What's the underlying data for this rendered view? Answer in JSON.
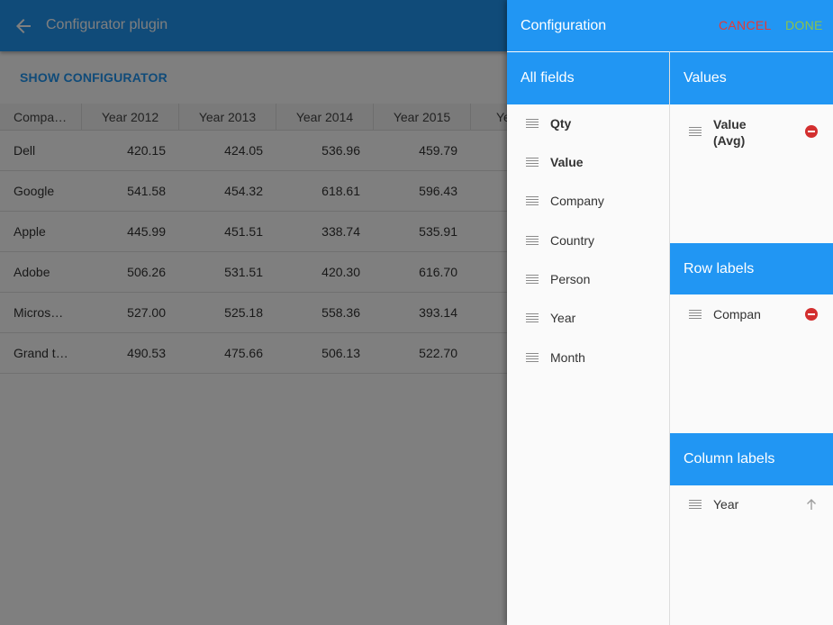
{
  "app": {
    "title": "Configurator plugin",
    "show_button": "SHOW CONFIGURATOR",
    "grid": {
      "headers": [
        "Compa…",
        "Year 2012",
        "Year 2013",
        "Year 2014",
        "Year 2015",
        "Ye"
      ],
      "rows": [
        [
          "Dell",
          "420.15",
          "424.05",
          "536.96",
          "459.79"
        ],
        [
          "Google",
          "541.58",
          "454.32",
          "618.61",
          "596.43"
        ],
        [
          "Apple",
          "445.99",
          "451.51",
          "338.74",
          "535.91"
        ],
        [
          "Adobe",
          "506.26",
          "531.51",
          "420.30",
          "616.70"
        ],
        [
          "Micros…",
          "527.00",
          "525.18",
          "558.36",
          "393.14"
        ],
        [
          "Grand t…",
          "490.53",
          "475.66",
          "506.13",
          "522.70"
        ]
      ]
    }
  },
  "config": {
    "title": "Configuration",
    "cancel": "CANCEL",
    "done": "DONE",
    "all_fields": {
      "title": "All fields",
      "items": [
        "Qty",
        "Value",
        "Company",
        "Country",
        "Person",
        "Year",
        "Month"
      ]
    },
    "values": {
      "title": "Values",
      "items": [
        "Value (Avg)"
      ]
    },
    "row_labels": {
      "title": "Row labels",
      "items": [
        "Compan"
      ]
    },
    "column_labels": {
      "title": "Column labels",
      "items": [
        "Year"
      ]
    }
  },
  "colors": {
    "primary": "#2196f3",
    "cancel": "#e53935",
    "done": "#8bc34a",
    "remove": "#d32f2f"
  },
  "icons": {
    "back": "arrow-left",
    "drag": "drag-handle",
    "remove": "minus-circle",
    "sort": "arrow-up"
  }
}
